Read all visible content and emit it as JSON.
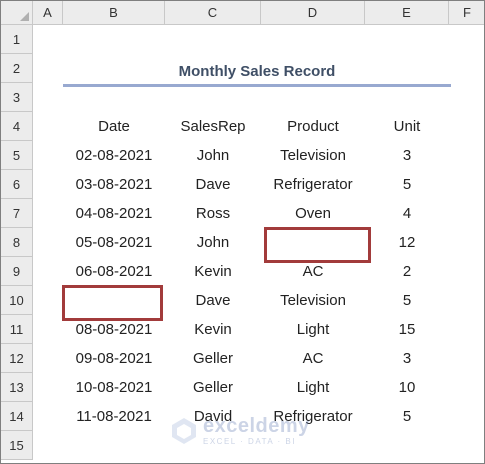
{
  "columns": [
    "A",
    "B",
    "C",
    "D",
    "E",
    "F"
  ],
  "rows": [
    "1",
    "2",
    "3",
    "4",
    "5",
    "6",
    "7",
    "8",
    "9",
    "10",
    "11",
    "12",
    "13",
    "14",
    "15"
  ],
  "title": "Monthly Sales Record",
  "headers": {
    "date": "Date",
    "salesrep": "SalesRep",
    "product": "Product",
    "unit": "Unit"
  },
  "records": [
    {
      "date": "02-08-2021",
      "salesrep": "John",
      "product": "Television",
      "unit": "3"
    },
    {
      "date": "03-08-2021",
      "salesrep": "Dave",
      "product": "Refrigerator",
      "unit": "5"
    },
    {
      "date": "04-08-2021",
      "salesrep": "Ross",
      "product": "Oven",
      "unit": "4"
    },
    {
      "date": "05-08-2021",
      "salesrep": "John",
      "product": "",
      "unit": "12"
    },
    {
      "date": "06-08-2021",
      "salesrep": "Kevin",
      "product": "AC",
      "unit": "2"
    },
    {
      "date": "",
      "salesrep": "Dave",
      "product": "Television",
      "unit": "5"
    },
    {
      "date": "08-08-2021",
      "salesrep": "Kevin",
      "product": "Light",
      "unit": "15"
    },
    {
      "date": "09-08-2021",
      "salesrep": "Geller",
      "product": "AC",
      "unit": "3"
    },
    {
      "date": "10-08-2021",
      "salesrep": "Geller",
      "product": "Light",
      "unit": "10"
    },
    {
      "date": "11-08-2021",
      "salesrep": "David",
      "product": "Refrigerator",
      "unit": "5"
    }
  ],
  "watermark": {
    "brand": "exceldemy",
    "tagline": "EXCEL · DATA · BI"
  },
  "colors": {
    "title": "#3f4f66",
    "title_rule": "#98a9d0",
    "highlight_border": "#a23b3b",
    "header_bg": "#ececec"
  }
}
